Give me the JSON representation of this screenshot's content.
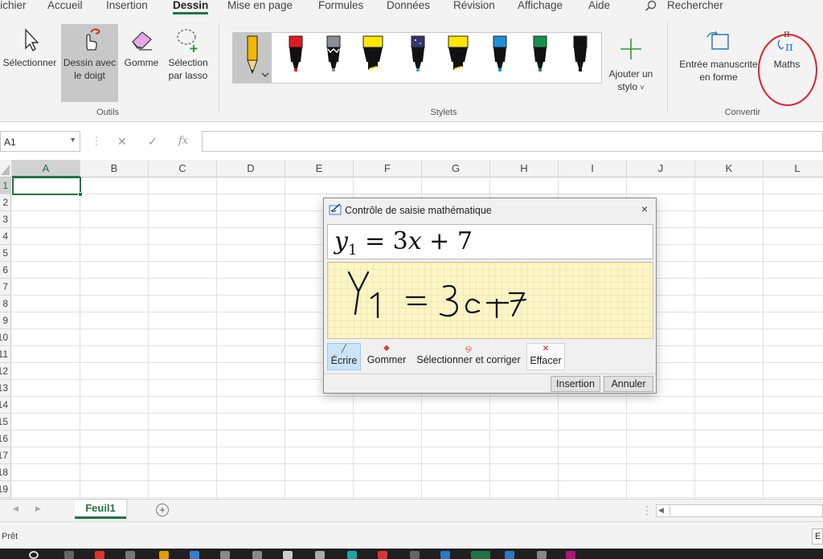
{
  "tabs": [
    {
      "label": "Fichier",
      "active": false
    },
    {
      "label": "Accueil",
      "active": false
    },
    {
      "label": "Insertion",
      "active": false
    },
    {
      "label": "Dessin",
      "active": true
    },
    {
      "label": "Mise en page",
      "active": false
    },
    {
      "label": "Formules",
      "active": false
    },
    {
      "label": "Données",
      "active": false
    },
    {
      "label": "Révision",
      "active": false
    },
    {
      "label": "Affichage",
      "active": false
    },
    {
      "label": "Aide",
      "active": false
    }
  ],
  "search": {
    "label": "Rechercher",
    "icon": "search-icon"
  },
  "ribbon": {
    "tools": {
      "select_line1": "Sélectionner",
      "draw_line1": "Dessin avec",
      "draw_line2": "le doigt",
      "eraser": "Gomme",
      "lasso_line1": "Sélection",
      "lasso_line2": "par lasso",
      "group_label": "Outils"
    },
    "pens": {
      "group_label": "Stylets",
      "items": [
        {
          "kind": "pencil",
          "color": "#f2b705"
        },
        {
          "kind": "pen",
          "color": "#e21b23"
        },
        {
          "kind": "pen-galaxy",
          "color": "#8a8f96"
        },
        {
          "kind": "highlighter",
          "color": "#ffe600"
        },
        {
          "kind": "pen-galaxy",
          "color": "#38356c"
        },
        {
          "kind": "highlighter",
          "color": "#ffe600"
        },
        {
          "kind": "pen",
          "color": "#1e90d8"
        },
        {
          "kind": "pen",
          "color": "#14914a"
        },
        {
          "kind": "pen",
          "color": "#111111"
        }
      ],
      "add_line1": "Ajouter un",
      "add_line2": "stylo",
      "add_chevron": "˅"
    },
    "convert": {
      "ink_line1": "Entrée manuscrite",
      "ink_line2": "en forme",
      "maths": "Maths",
      "group_label": "Convertir"
    }
  },
  "formula_bar": {
    "name_box": "A1",
    "cancel_glyph": "✕",
    "enter_glyph": "✓",
    "fx_glyph": "fx",
    "value": ""
  },
  "columns": [
    "A",
    "B",
    "C",
    "D",
    "E",
    "F",
    "G",
    "H",
    "I",
    "J",
    "K",
    "L"
  ],
  "rows": [
    "1",
    "2",
    "3",
    "4",
    "5",
    "6",
    "7",
    "8",
    "9",
    "10",
    "11",
    "12",
    "13",
    "14",
    "15",
    "16",
    "17",
    "18",
    "19"
  ],
  "dialog": {
    "title": "Contrôle de saisie mathématique",
    "close": "×",
    "preview_base": "y",
    "preview_sub": "1",
    "preview_rest": " = 3",
    "preview_var": "x",
    "preview_tail": " + 7",
    "tools": [
      {
        "label": "Écrire",
        "icon": "pen-write-icon",
        "active": true
      },
      {
        "label": "Gommer",
        "icon": "eraser-icon",
        "active": false
      },
      {
        "label": "Sélectionner et corriger",
        "icon": "lasso-correct-icon",
        "active": false
      },
      {
        "label": "Effacer",
        "icon": "clear-x-icon",
        "active": false
      }
    ],
    "insert_button": "Insertion",
    "cancel_button": "Annuler"
  },
  "sheet": {
    "name": "Feuil1",
    "add": "+"
  },
  "status": {
    "text": "Prêt",
    "right_fragment": "E"
  },
  "colors": {
    "accent": "#217346",
    "highlight_circle": "#e0202a"
  }
}
